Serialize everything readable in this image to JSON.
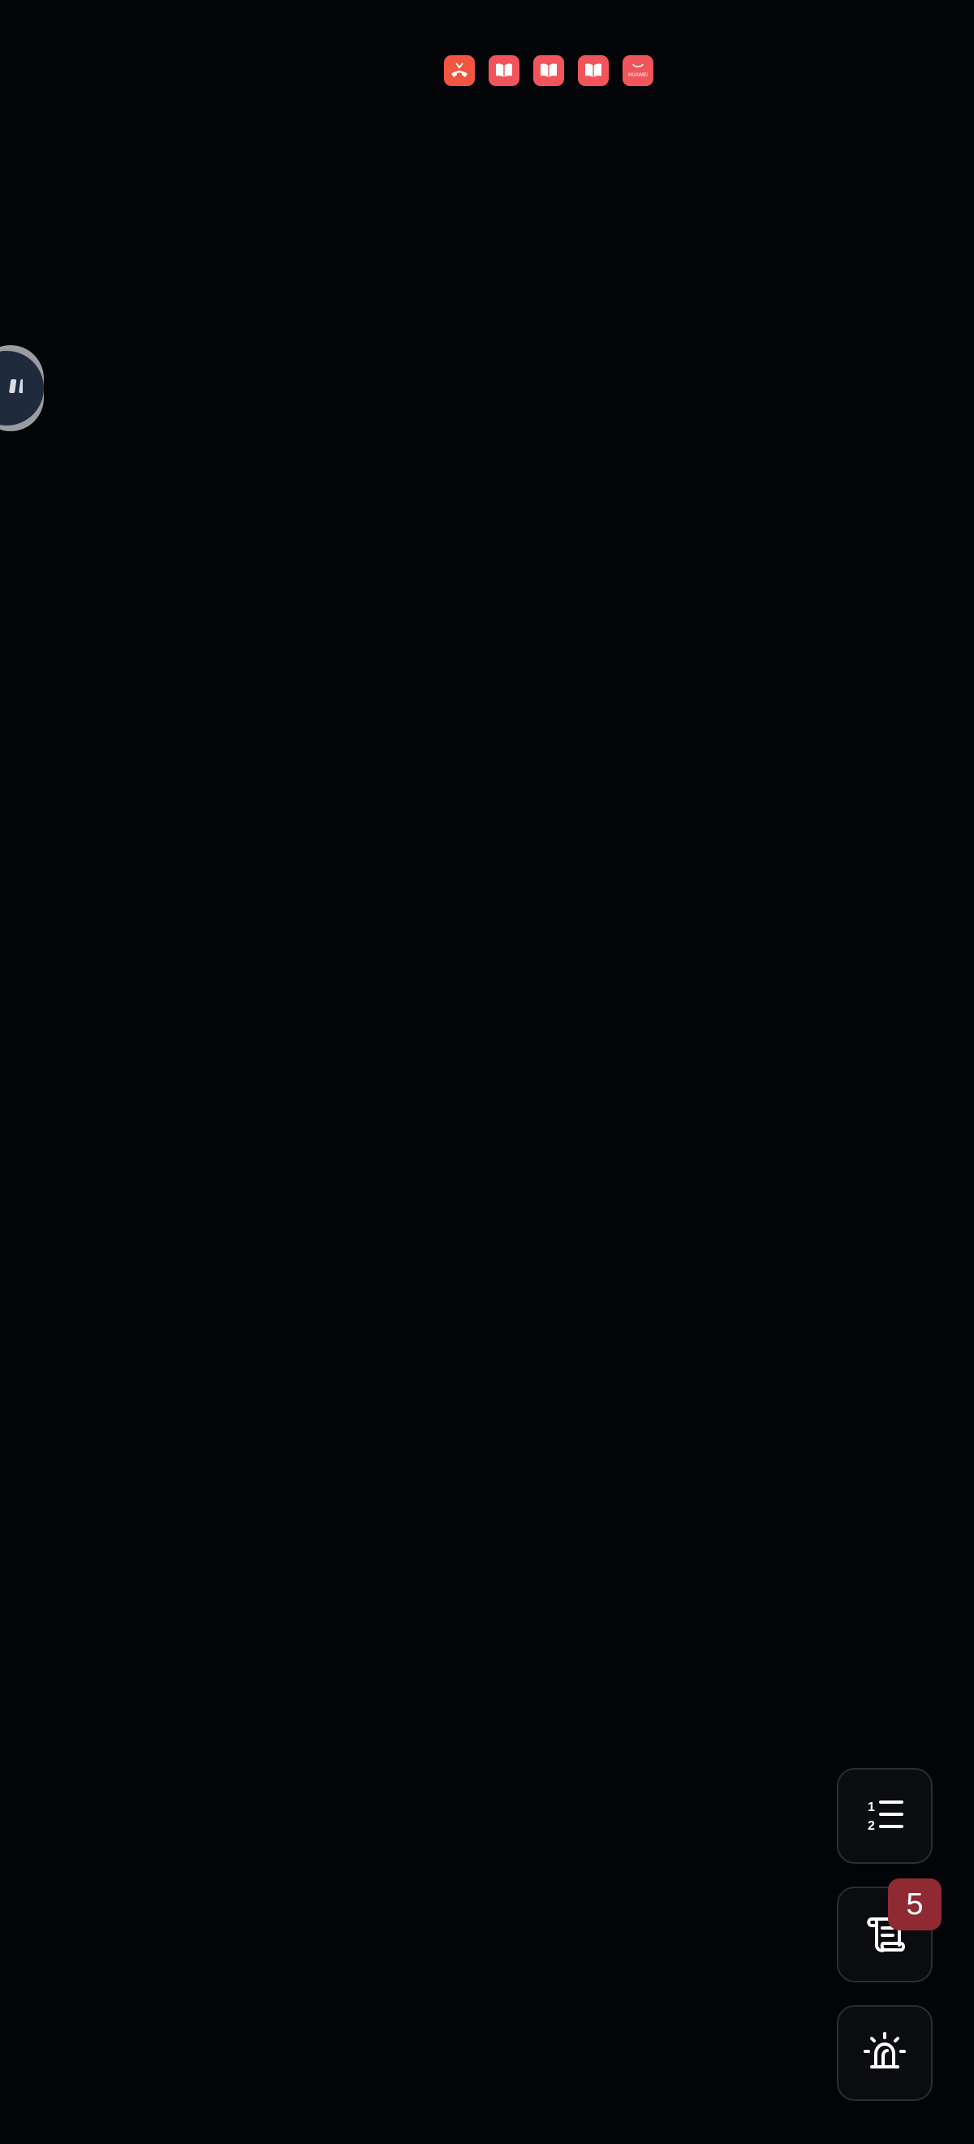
{
  "status_bar": {
    "notification_icons": [
      {
        "name": "missed-call-icon",
        "color": "#f1543f"
      },
      {
        "name": "book-icon",
        "color": "#f2545b"
      },
      {
        "name": "book-icon",
        "color": "#f2545b"
      },
      {
        "name": "book-icon",
        "color": "#f2545b"
      },
      {
        "name": "huawei-appgallery-icon",
        "color": "#f2545b"
      }
    ],
    "appgallery_label": "HUAWEI"
  },
  "floating_assistant": {
    "icon": "assistant-face-icon"
  },
  "actions": {
    "list_button_icon": "numbered-list-icon",
    "log_button_icon": "scroll-icon",
    "log_badge_count": "5",
    "alarm_button_icon": "siren-icon"
  },
  "colors": {
    "background": "#030407",
    "badge": "#8f2a32",
    "notification": "#f2545b"
  }
}
